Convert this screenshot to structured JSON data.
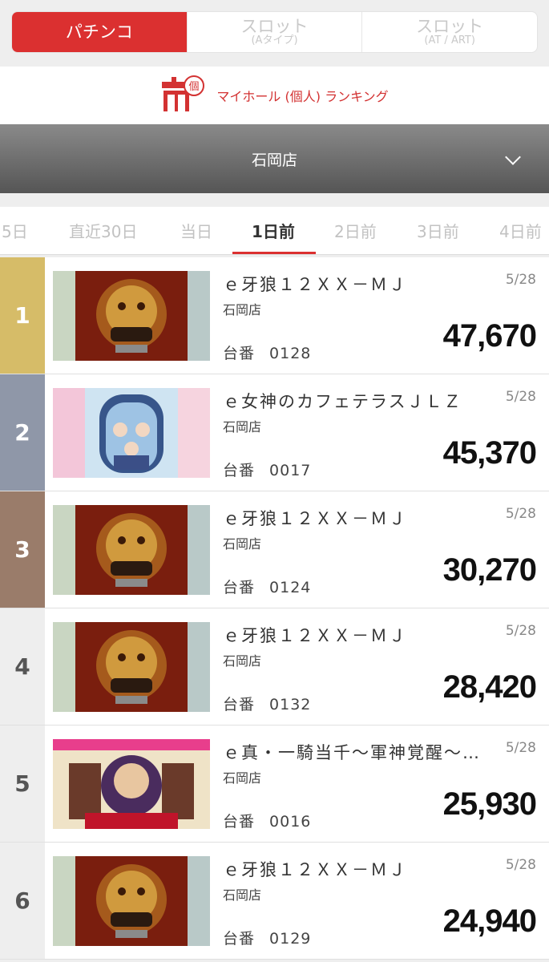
{
  "machine_tabs": [
    {
      "label": "パチンコ",
      "sub": "",
      "active": true
    },
    {
      "label": "スロット",
      "sub": "(Aタイプ)",
      "active": false
    },
    {
      "label": "スロット",
      "sub": "(AT / ART)",
      "active": false
    }
  ],
  "banner": {
    "label": "マイホール (個人) ランキング",
    "badge": "個"
  },
  "store": {
    "name": "石岡店"
  },
  "date_tabs": [
    "5日",
    "直近30日",
    "当日",
    "1日前",
    "2日前",
    "3日前",
    "4日前"
  ],
  "active_date_tab": "1日前",
  "colors": {
    "accent": "#db3030",
    "gold": "#d6bc68",
    "silver": "#8f97a8",
    "bronze": "#9a7c6a"
  },
  "ranking": [
    {
      "rank": "1",
      "title": "ｅ牙狼１２ＸＸ－ＭＪ",
      "date": "5/28",
      "shop": "石岡店",
      "machine_label": "台番",
      "machine_no": "0128",
      "value": "47,670",
      "thumb": "garo"
    },
    {
      "rank": "2",
      "title": "ｅ女神のカフェテラスＪＬＺ",
      "date": "5/28",
      "shop": "石岡店",
      "machine_label": "台番",
      "machine_no": "0017",
      "value": "45,370",
      "thumb": "cafe"
    },
    {
      "rank": "3",
      "title": "ｅ牙狼１２ＸＸ－ＭＪ",
      "date": "5/28",
      "shop": "石岡店",
      "machine_label": "台番",
      "machine_no": "0124",
      "value": "30,270",
      "thumb": "garo"
    },
    {
      "rank": "4",
      "title": "ｅ牙狼１２ＸＸ－ＭＪ",
      "date": "5/28",
      "shop": "石岡店",
      "machine_label": "台番",
      "machine_no": "0132",
      "value": "28,420",
      "thumb": "garo"
    },
    {
      "rank": "5",
      "title": "ｅ真・一騎当千～軍神覚醒～…",
      "date": "5/28",
      "shop": "石岡店",
      "machine_label": "台番",
      "machine_no": "0016",
      "value": "25,930",
      "thumb": "ikki"
    },
    {
      "rank": "6",
      "title": "ｅ牙狼１２ＸＸ－ＭＪ",
      "date": "5/28",
      "shop": "石岡店",
      "machine_label": "台番",
      "machine_no": "0129",
      "value": "24,940",
      "thumb": "garo"
    }
  ]
}
